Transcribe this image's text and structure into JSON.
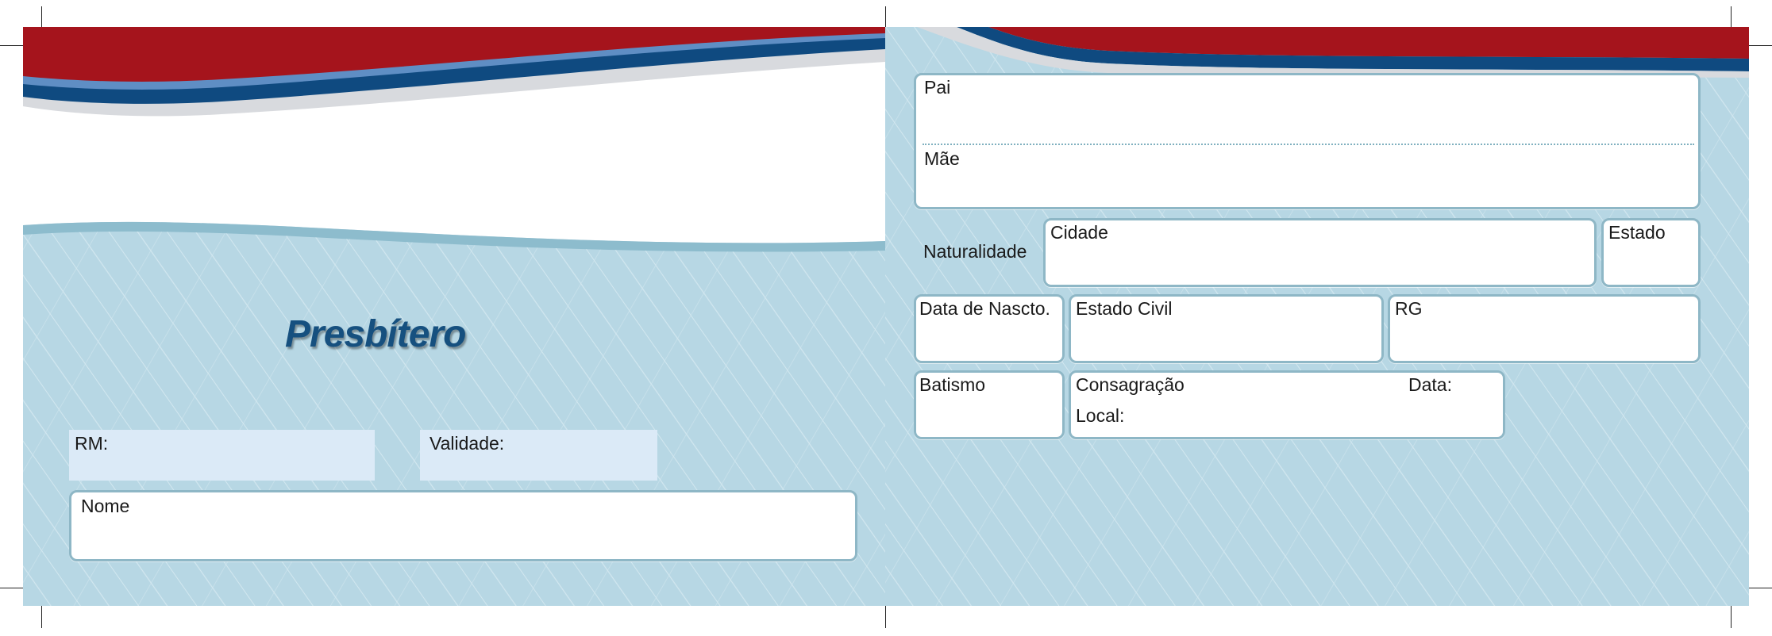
{
  "front": {
    "title": "Presbítero",
    "rm_label": "RM:",
    "validade_label": "Validade:",
    "nome_label": "Nome"
  },
  "back": {
    "pai_label": "Pai",
    "mae_label": "Mãe",
    "naturalidade_label": "Naturalidade",
    "cidade_label": "Cidade",
    "estado_label": "Estado",
    "data_nascto_label": "Data de Nascto.",
    "estado_civil_label": "Estado Civil",
    "rg_label": "RG",
    "batismo_label": "Batismo",
    "consagracao_label": "Consagração",
    "data_label": "Data:",
    "local_label": "Local:"
  },
  "colors": {
    "red_band": "#a5141c",
    "blue_band": "#0f4a80",
    "card_bg": "#b7d7e4",
    "field_border": "#8eb7c6",
    "title_color": "#16507f"
  }
}
